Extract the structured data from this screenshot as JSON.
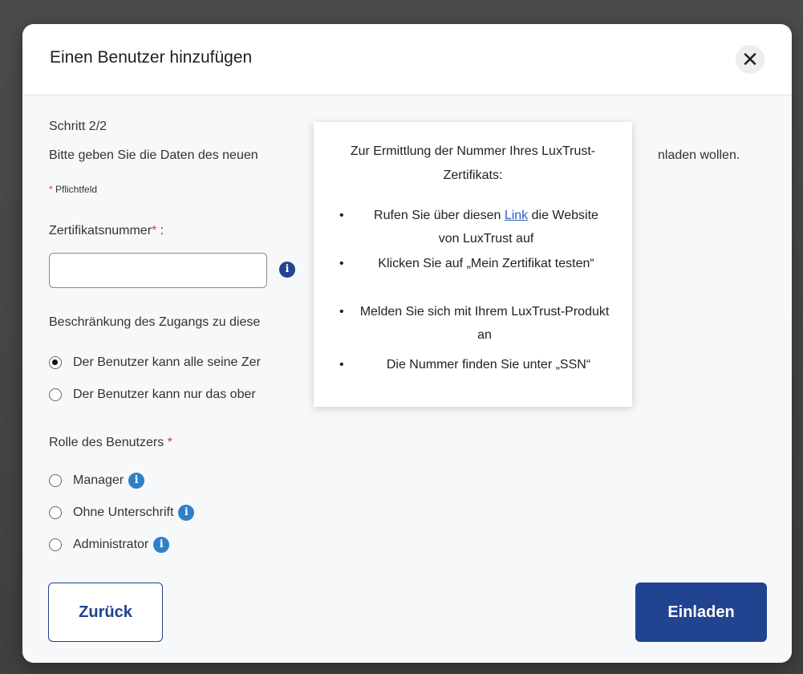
{
  "modal": {
    "title": "Einen Benutzer hinzufügen",
    "close_label": "✕"
  },
  "form": {
    "step": "Schritt 2/2",
    "description_start": "Bitte geben Sie die Daten des neuen",
    "description_end": "nladen wollen.",
    "required_note": "Pflichtfeld",
    "required_star": "*",
    "cert_label": "Zertifikatsnummer",
    "cert_label_suffix": " :",
    "cert_value": "",
    "access_label": "Beschränkung des Zugangs zu diese",
    "access_options": [
      {
        "label": "Der Benutzer kann alle seine Zer",
        "checked": true
      },
      {
        "label": "Der Benutzer kann nur das ober",
        "checked": false
      }
    ],
    "role_label": "Rolle des Benutzers",
    "role_options": [
      {
        "label": "Manager",
        "checked": false
      },
      {
        "label": "Ohne Unterschrift",
        "checked": false
      },
      {
        "label": "Administrator",
        "checked": false
      }
    ]
  },
  "buttons": {
    "back": "Zurück",
    "invite": "Einladen"
  },
  "tooltip": {
    "title": "Zur Ermittlung der Nummer Ihres LuxTrust-Zertifikats:",
    "item1_before": "Rufen Sie über diesen ",
    "item1_link": "Link",
    "item1_after": " die Website von LuxTrust auf",
    "item2": "Klicken Sie auf „Mein Zertifikat testen“",
    "item3": "Melden Sie sich mit Ihrem LuxTrust-Produkt an",
    "item4": "Die Nummer finden Sie unter „SSN“",
    "bullet": "•"
  },
  "icons": {
    "info": "i"
  },
  "colors": {
    "primary": "#22438f",
    "info_light": "#2f7fc9",
    "required": "#dd3333"
  }
}
